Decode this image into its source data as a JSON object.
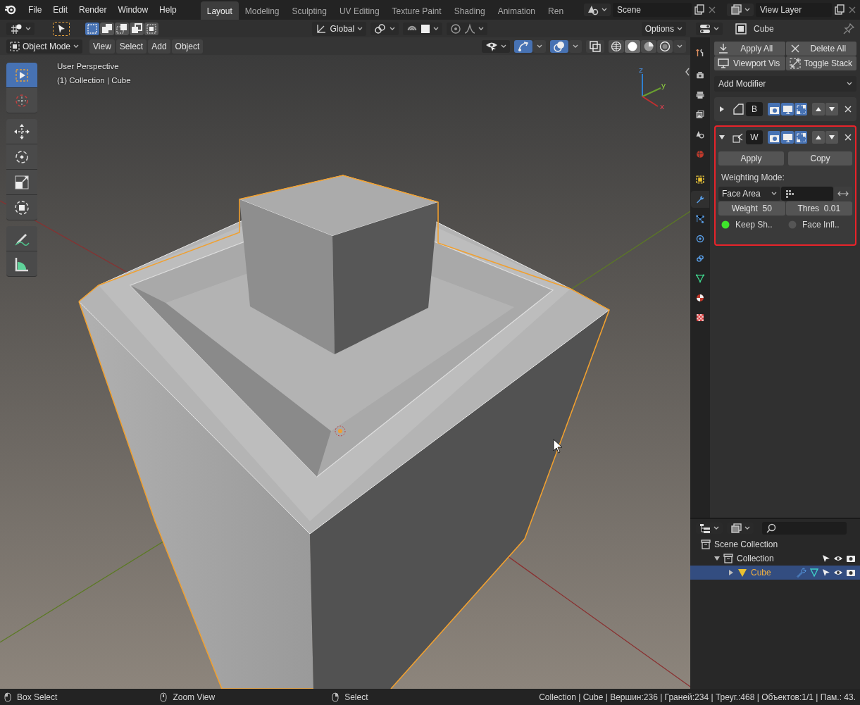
{
  "menu_bar": {
    "items": [
      "File",
      "Edit",
      "Render",
      "Window",
      "Help"
    ]
  },
  "workspace_tabs": [
    {
      "label": "Layout",
      "selected": true
    },
    {
      "label": "Modeling",
      "selected": false
    },
    {
      "label": "Sculpting",
      "selected": false
    },
    {
      "label": "UV Editing",
      "selected": false
    },
    {
      "label": "Texture Paint",
      "selected": false
    },
    {
      "label": "Shading",
      "selected": false
    },
    {
      "label": "Animation",
      "selected": false
    },
    {
      "label": "Ren",
      "selected": false
    }
  ],
  "scene": {
    "value": "Scene"
  },
  "view_layer": {
    "value": "View Layer"
  },
  "tool_header": {
    "select_modes": [
      {
        "kind": "set",
        "selected": true
      },
      {
        "kind": "extend",
        "selected": false
      },
      {
        "kind": "subtract",
        "selected": false
      },
      {
        "kind": "invert",
        "selected": false
      },
      {
        "kind": "intersect",
        "selected": false
      }
    ],
    "orientation": "Global",
    "options": "Options"
  },
  "viewport_header": {
    "mode": "Object Mode",
    "menus": [
      "View",
      "Select",
      "Add",
      "Object"
    ],
    "gizmos_on": true,
    "overlays_on": true,
    "xray_on": false,
    "shading": [
      {
        "kind": "wireframe",
        "selected": false
      },
      {
        "kind": "solid",
        "selected": true
      },
      {
        "kind": "material",
        "selected": false
      },
      {
        "kind": "rendered",
        "selected": false
      }
    ]
  },
  "viewport": {
    "overlay_lines": [
      "User Perspective",
      "(1) Collection | Cube"
    ],
    "gizmo_axes": [
      "z",
      "y",
      "x"
    ]
  },
  "toolbar": {
    "tools": [
      {
        "kind": "select",
        "selected": true
      },
      {
        "kind": "cursor",
        "selected": false
      },
      {
        "kind": "move",
        "selected": false
      },
      {
        "kind": "rotate",
        "selected": false
      },
      {
        "kind": "scale",
        "selected": false
      },
      {
        "kind": "transform",
        "selected": false
      },
      {
        "kind": "annotate",
        "selected": false
      },
      {
        "kind": "measure",
        "selected": false
      }
    ]
  },
  "properties": {
    "object": "Cube",
    "tabs": [
      {
        "kind": "tool",
        "selected": false
      },
      {
        "kind": "render",
        "selected": false
      },
      {
        "kind": "output",
        "selected": false
      },
      {
        "kind": "view_layer",
        "selected": false
      },
      {
        "kind": "scene",
        "selected": false
      },
      {
        "kind": "world",
        "selected": false
      },
      {
        "kind": "object",
        "selected": false
      },
      {
        "kind": "modifiers",
        "selected": true
      },
      {
        "kind": "particles",
        "selected": false
      },
      {
        "kind": "physics",
        "selected": false
      },
      {
        "kind": "constraints",
        "selected": false
      },
      {
        "kind": "data",
        "selected": false
      },
      {
        "kind": "material",
        "selected": false
      },
      {
        "kind": "texture",
        "selected": false
      }
    ],
    "buttons": [
      {
        "kind": "apply",
        "label": "Apply All"
      },
      {
        "kind": "delete",
        "label": "Delete All"
      },
      {
        "kind": "viewport",
        "label": "Viewport Vis"
      },
      {
        "kind": "toggle",
        "label": "Toggle Stack"
      }
    ],
    "add_modifier": "Add Modifier",
    "modifiers": [
      {
        "name": "B",
        "kind": "bevel",
        "expanded": false,
        "highlighted": false,
        "toggles": [
          {
            "kind": "render",
            "on": true
          },
          {
            "kind": "viewport",
            "on": true
          },
          {
            "kind": "edit",
            "on": true
          }
        ]
      },
      {
        "name": "W",
        "kind": "weighted_normal",
        "expanded": true,
        "highlighted": true,
        "toggles": [
          {
            "kind": "render",
            "on": true
          },
          {
            "kind": "viewport",
            "on": true
          },
          {
            "kind": "edit",
            "on": true
          }
        ],
        "apply": "Apply",
        "copy": "Copy",
        "mode_label": "Weighting Mode:",
        "mode": "Face Area",
        "weight": {
          "label": "Weight",
          "value": "50"
        },
        "threshold": {
          "label": "Thres",
          "value": "0.01"
        },
        "options": [
          {
            "label": "Keep Sh..",
            "checked": true
          },
          {
            "label": "Face Infl..",
            "checked": false
          }
        ]
      }
    ]
  },
  "outliner": {
    "items": [
      {
        "label": "Scene Collection",
        "kind": "scene_collection",
        "selected": false,
        "children": [
          {
            "label": "Collection",
            "kind": "collection",
            "expanded": true,
            "selected": false,
            "children": [
              {
                "label": "Cube",
                "kind": "mesh",
                "expanded": false,
                "selected": true
              }
            ]
          }
        ]
      }
    ]
  },
  "status_bar": {
    "hints": [
      "Box Select",
      "Zoom View",
      "Select"
    ],
    "info": "Collection | Cube | Вершин:236 | Граней:234 | Треуг.:468 | Объектов:1/1 | Пам.: 43."
  }
}
